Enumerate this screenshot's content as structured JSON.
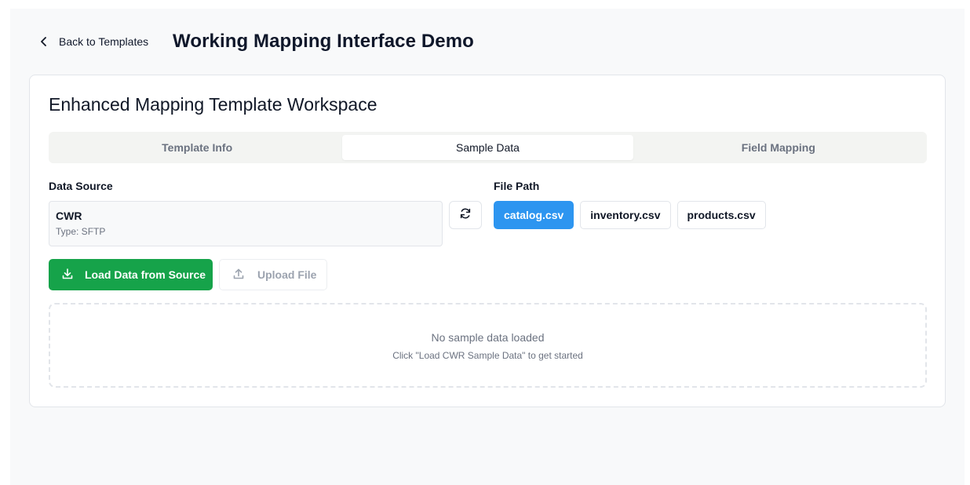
{
  "header": {
    "back_label": "Back to Templates",
    "title": "Working Mapping Interface Demo"
  },
  "workspace": {
    "title": "Enhanced Mapping Template Workspace",
    "tabs": [
      {
        "label": "Template Info",
        "active": false
      },
      {
        "label": "Sample Data",
        "active": true
      },
      {
        "label": "Field Mapping",
        "active": false
      }
    ]
  },
  "data_source": {
    "label": "Data Source",
    "name": "CWR",
    "type": "Type: SFTP"
  },
  "file_path": {
    "label": "File Path",
    "files": [
      {
        "name": "catalog.csv",
        "selected": true
      },
      {
        "name": "inventory.csv",
        "selected": false
      },
      {
        "name": "products.csv",
        "selected": false
      }
    ]
  },
  "actions": {
    "load_label": "Load Data from Source",
    "upload_label": "Upload File"
  },
  "empty_state": {
    "title": "No sample data loaded",
    "hint": "Click \"Load CWR Sample Data\" to get started"
  },
  "icons": {
    "back": "chevron-left-icon",
    "refresh": "refresh-icon",
    "load": "download-icon",
    "upload": "upload-icon"
  },
  "colors": {
    "primary_green": "#16a34a",
    "selected_blue": "#2d95f0",
    "page_bg": "#f8f9fa"
  }
}
